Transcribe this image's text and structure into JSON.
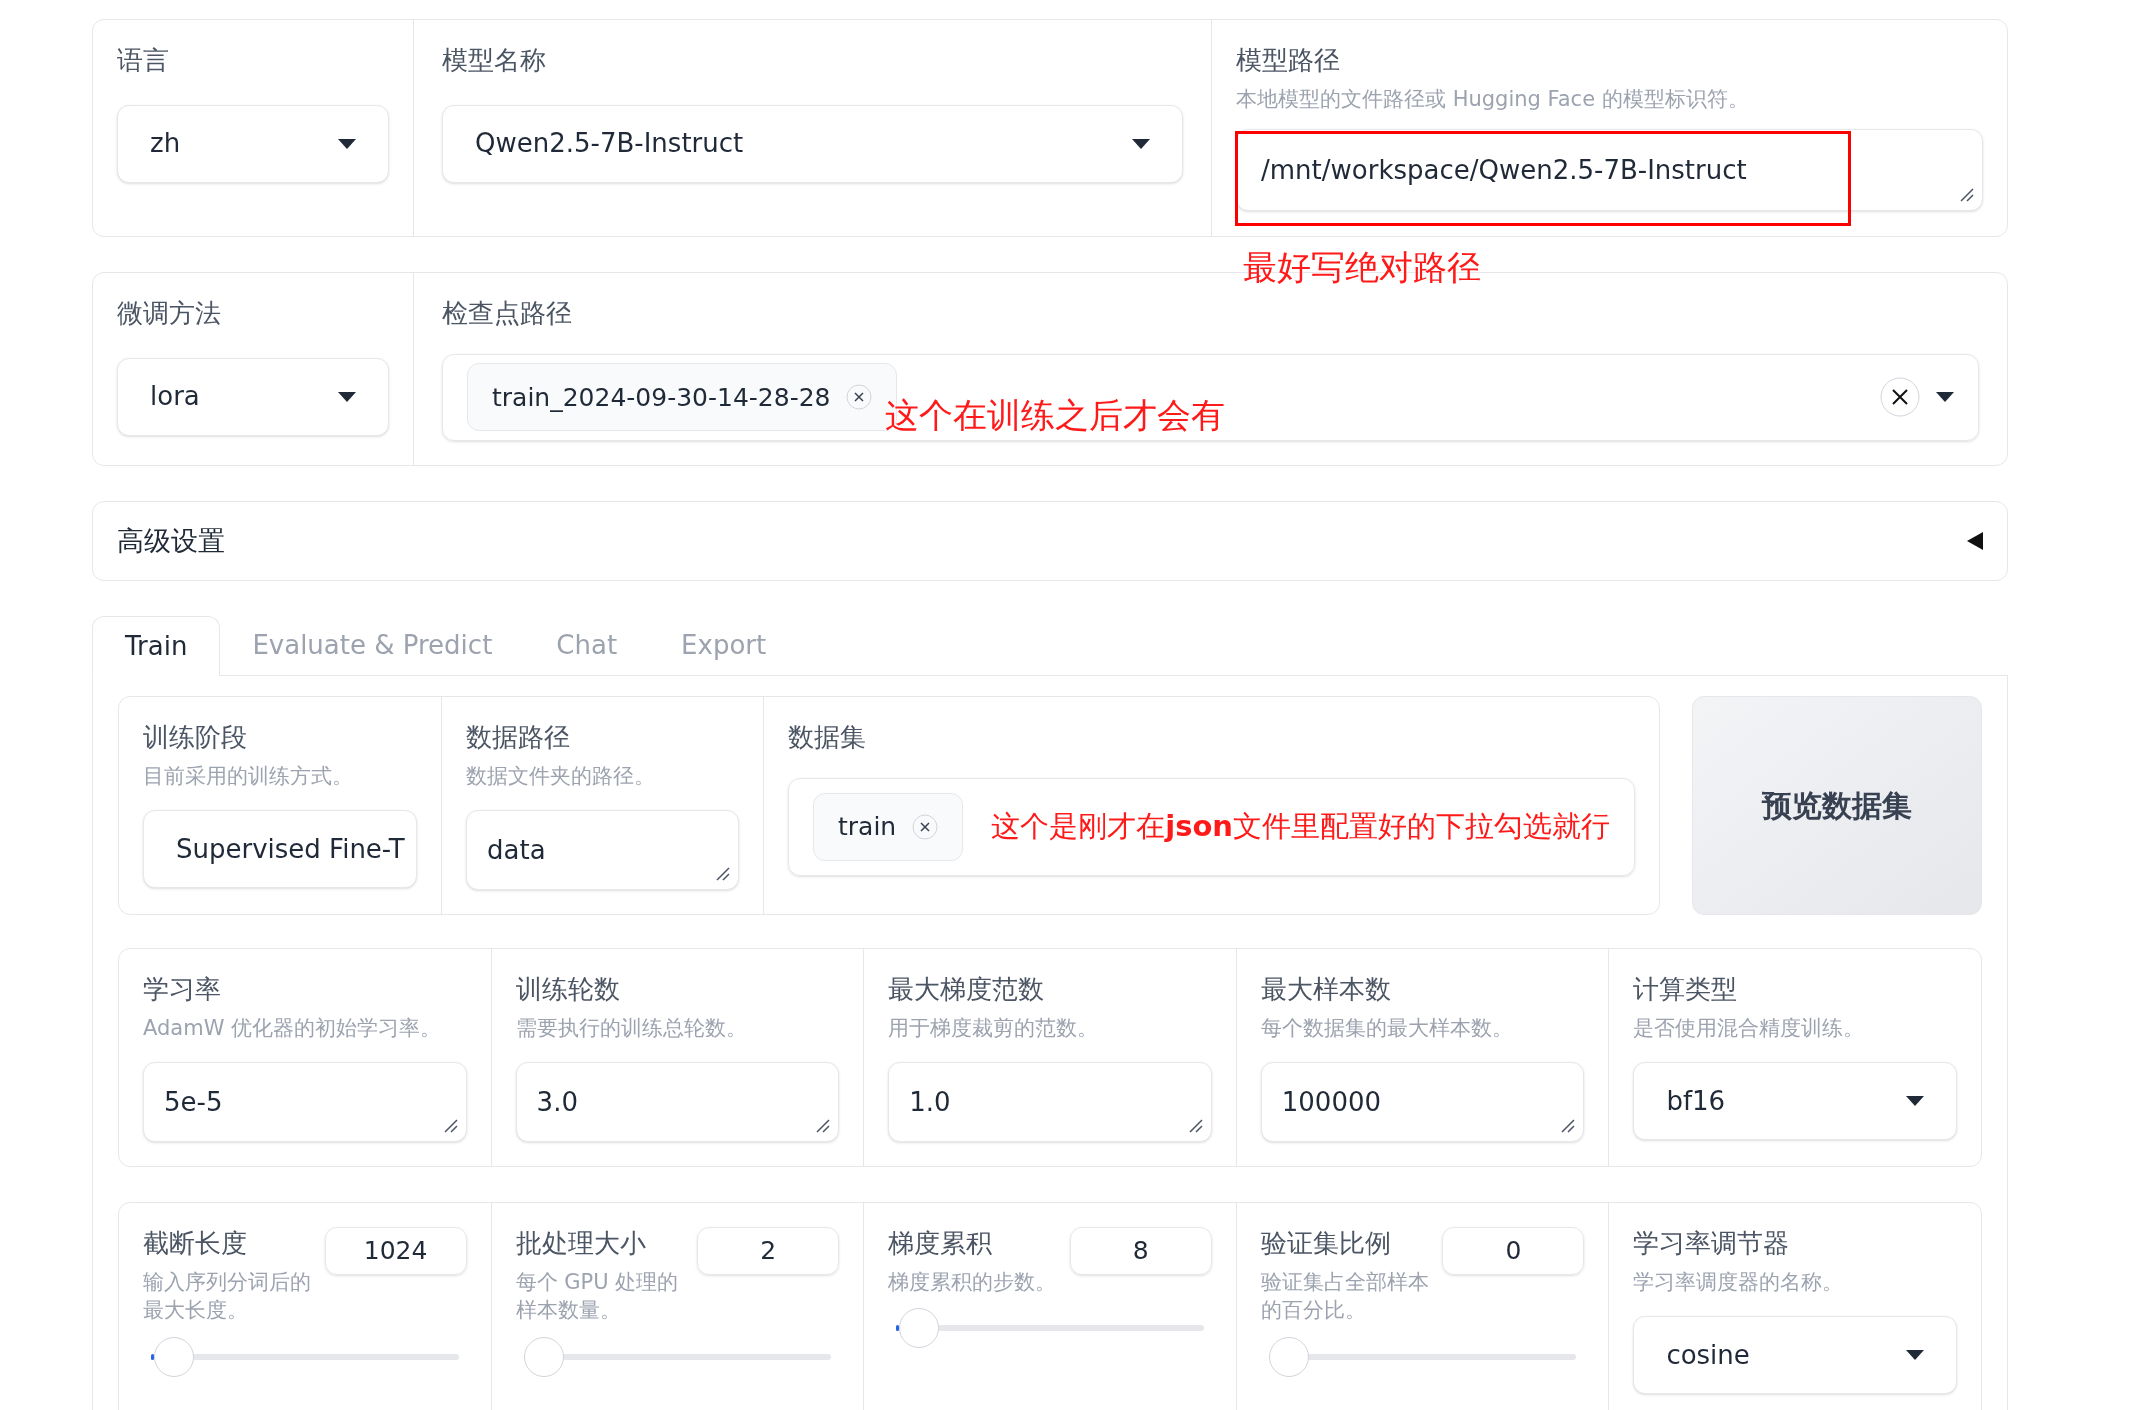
{
  "language": {
    "label": "语言",
    "value": "zh"
  },
  "model_name": {
    "label": "模型名称",
    "value": "Qwen2.5-7B-Instruct"
  },
  "model_path": {
    "label": "模型路径",
    "info": "本地模型的文件路径或 Hugging Face 的模型标识符。",
    "value": "/mnt/workspace/Qwen2.5-7B-Instruct"
  },
  "finetuning_method": {
    "label": "微调方法",
    "value": "lora"
  },
  "checkpoint_path": {
    "label": "检查点路径",
    "tags": [
      {
        "text": "train_2024-09-30-14-28-28"
      }
    ]
  },
  "advanced_settings": {
    "title": "高级设置",
    "expanded": false
  },
  "tabs": [
    {
      "label": "Train",
      "selected": true
    },
    {
      "label": "Evaluate & Predict",
      "selected": false
    },
    {
      "label": "Chat",
      "selected": false
    },
    {
      "label": "Export",
      "selected": false
    }
  ],
  "training_stage": {
    "label": "训练阶段",
    "info": "目前采用的训练方式。",
    "value": "Supervised Fine-T"
  },
  "data_dir": {
    "label": "数据路径",
    "info": "数据文件夹的路径。",
    "value": "data"
  },
  "dataset": {
    "label": "数据集",
    "tags": [
      {
        "text": "train"
      }
    ]
  },
  "preview_button": "预览数据集",
  "params_row": [
    {
      "kind": "textbox",
      "label": "学习率",
      "info": "AdamW 优化器的初始学习率。",
      "value": "5e-5"
    },
    {
      "kind": "textbox",
      "label": "训练轮数",
      "info": "需要执行的训练总轮数。",
      "value": "3.0"
    },
    {
      "kind": "textbox",
      "label": "最大梯度范数",
      "info": "用于梯度裁剪的范数。",
      "value": "1.0"
    },
    {
      "kind": "textbox",
      "label": "最大样本数",
      "info": "每个数据集的最大样本数。",
      "value": "100000"
    },
    {
      "kind": "dropdown",
      "label": "计算类型",
      "info": "是否使用混合精度训练。",
      "value": "bf16"
    }
  ],
  "params_row_2": [
    {
      "kind": "slider",
      "label": "截断长度",
      "info": "输入序列分词后的最大长度。",
      "value": "1024",
      "level": 0.01
    },
    {
      "kind": "slider",
      "label": "批处理大小",
      "info": "每个 GPU 处理的样本数量。",
      "value": "2",
      "level": 0
    },
    {
      "kind": "slider",
      "label": "梯度累积",
      "info": "梯度累积的步数。",
      "value": "8",
      "level": 0.01
    },
    {
      "kind": "slider",
      "label": "验证集比例",
      "info": "验证集占全部样本的百分比。",
      "value": "0",
      "level": 0
    },
    {
      "kind": "dropdown",
      "label": "学习率调节器",
      "info": "学习率调度器的名称。",
      "value": "cosine"
    }
  ],
  "annotations": [
    {
      "text": "最好写绝对路径"
    },
    {
      "text": "这个在训练之后才会有"
    },
    {
      "text": "这个是刚才在**json**文件里配置好的下拉勾选就行"
    }
  ]
}
